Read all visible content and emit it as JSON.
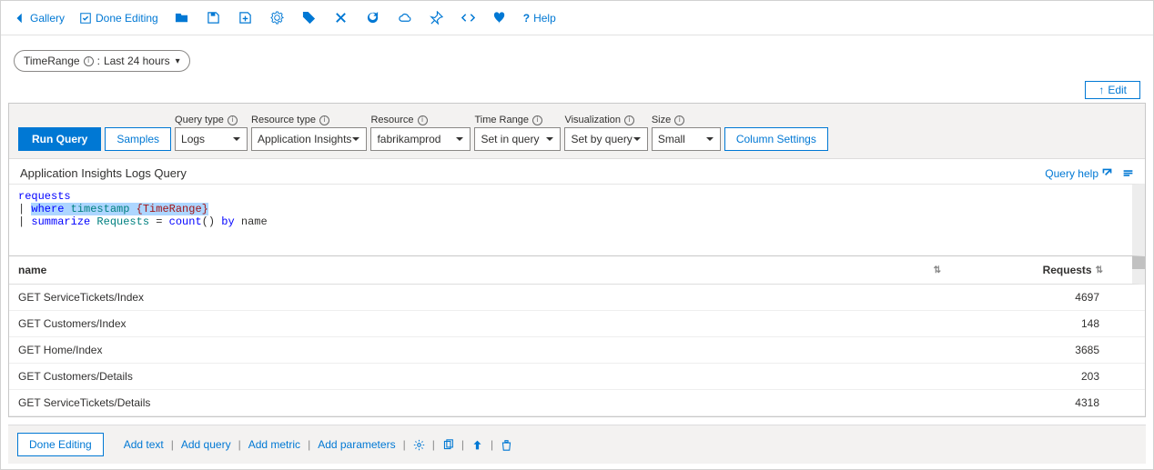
{
  "toolbar": {
    "gallery": "Gallery",
    "done_editing": "Done Editing",
    "help": "Help"
  },
  "parameters": {
    "pill": {
      "name": "TimeRange",
      "value": "Last 24 hours"
    },
    "edit_label": "Edit"
  },
  "query": {
    "run_label": "Run Query",
    "samples_label": "Samples",
    "column_settings": "Column Settings",
    "title": "Application Insights Logs Query",
    "help_label": "Query help",
    "fields": {
      "query_type": {
        "label": "Query type",
        "value": "Logs"
      },
      "resource_type": {
        "label": "Resource type",
        "value": "Application Insights"
      },
      "resource": {
        "label": "Resource",
        "value": "fabrikamprod"
      },
      "time_range": {
        "label": "Time Range",
        "value": "Set in query"
      },
      "visualization": {
        "label": "Visualization",
        "value": "Set by query"
      },
      "size": {
        "label": "Size",
        "value": "Small"
      }
    },
    "code": {
      "line1": "requests",
      "where": "where",
      "timestamp": "timestamp",
      "param": "{TimeRange}",
      "summarize": "summarize",
      "requests": "Requests",
      "count": "count",
      "by": "by",
      "name": "name"
    }
  },
  "results": {
    "columns": [
      "name",
      "Requests"
    ],
    "rows": [
      {
        "name": "GET ServiceTickets/Index",
        "requests": 4697
      },
      {
        "name": "GET Customers/Index",
        "requests": 148
      },
      {
        "name": "GET Home/Index",
        "requests": 3685
      },
      {
        "name": "GET Customers/Details",
        "requests": 203
      },
      {
        "name": "GET ServiceTickets/Details",
        "requests": 4318
      }
    ]
  },
  "footer": {
    "done_editing": "Done Editing",
    "add_text": "Add text",
    "add_query": "Add query",
    "add_metric": "Add metric",
    "add_parameters": "Add parameters"
  }
}
